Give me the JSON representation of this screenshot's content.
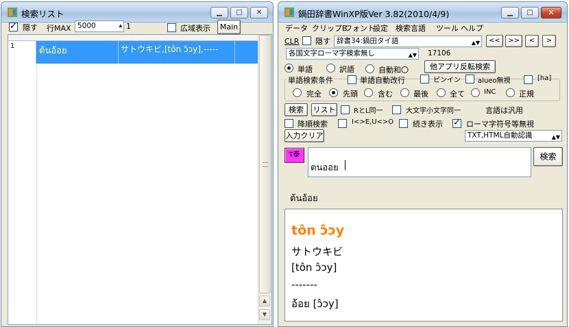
{
  "search_list_window": {
    "title": "検索リスト",
    "hide_label": "隠す",
    "row_max_label": "行MAX",
    "row_max_value": "5000",
    "spinner_value": "1",
    "wide_display_label": "広域表示",
    "main_button": "Main",
    "rows": [
      {
        "num": "1",
        "word": "ต้นอ้อย",
        "meaning": "サトウキビ,[tôn ɔ̂ɔy],-----"
      }
    ]
  },
  "dict_window": {
    "title": "鍋田辞書WinXP版Ver 3.82(2010/4/9)",
    "menu": [
      "データ",
      "クリップB",
      "フォント",
      "設定",
      "検索言語",
      "ツール",
      "ヘルプ"
    ],
    "clr_label": "CLR",
    "hide_label": "隠す",
    "dictionary_select": "辞書34:鍋田タイ語",
    "nav_buttons": [
      "<<",
      ">>",
      "<",
      ">"
    ],
    "roman_select": "各国文字ローマ字検索無し",
    "count": "17106",
    "radio_word": "単語",
    "radio_translation": "訳語",
    "radio_auto": "自動和〇",
    "reverse_button": "他アプリ反転検索",
    "group_label": "単語検索条件",
    "auto_newline_label": "単語自動改行",
    "pinyin_label": "ピンイン",
    "aiueo_label": "aiueo無視",
    "ha_label": "[ha]",
    "match_options": [
      "完全",
      "先頭",
      "含む",
      "最後",
      "全て",
      "INC",
      "正規"
    ],
    "search_button": "検索",
    "list_button": "リスト",
    "rl_same_label": "RとL同一",
    "case_same_label": "大文字小文字同一",
    "language_note": "言語は汎用",
    "descending_label": "降順検索",
    "io_eu_label": "I<>E,U<>O",
    "continue_label": "続き表示",
    "roman_ignore_label": "ローマ字符号等無視",
    "clear_button": "入力クリア",
    "txt_select": "TXT,HTML自動認識",
    "thai_button": "T泰",
    "input_value": "ตนออย",
    "search_button2": "検索",
    "result_word": "ต้นอ้อย",
    "result_heading": "tôn ɔ̂ɔy",
    "result_lines": [
      "サトウキビ",
      "[tôn ɔ̂ɔy]",
      "-------",
      "อ้อย [ɔ̂ɔy]"
    ]
  },
  "colors": {
    "selection": "#3399FF",
    "selection_text": "#FFFF66",
    "heading": "#FF8000",
    "thai_button": "#FF33FF"
  }
}
